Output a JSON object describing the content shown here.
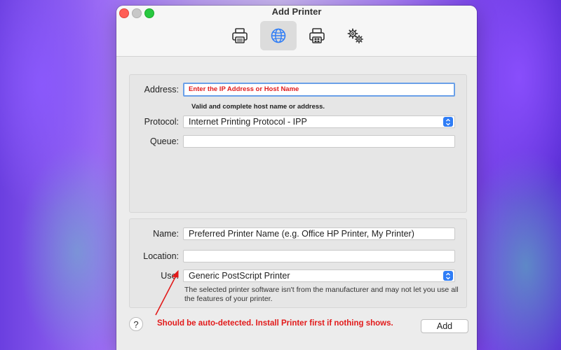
{
  "window": {
    "title": "Add Printer"
  },
  "toolbar": {
    "items": [
      {
        "icon": "printer-icon",
        "selected": false
      },
      {
        "icon": "globe-icon",
        "selected": true
      },
      {
        "icon": "windows-printer-icon",
        "selected": false
      },
      {
        "icon": "gears-icon",
        "selected": false
      }
    ]
  },
  "form": {
    "address": {
      "label": "Address:",
      "value": "Enter the IP Address or Host Name"
    },
    "address_hint": "Valid and complete host name or address.",
    "protocol": {
      "label": "Protocol:",
      "value": "Internet Printing Protocol - IPP"
    },
    "queue": {
      "label": "Queue:",
      "value": ""
    },
    "name": {
      "label": "Name:",
      "value": "Preferred Printer Name (e.g. Office HP Printer, My Printer)"
    },
    "location": {
      "label": "Location:",
      "value": ""
    },
    "use": {
      "label": "Use:",
      "value": "Generic PostScript Printer"
    },
    "use_note": "The selected printer software isn't from the manufacturer and may not let you use all the features of your printer."
  },
  "annotation": {
    "text": "Should be auto-detected. Install Printer first if nothing shows."
  },
  "buttons": {
    "help": "?",
    "add": "Add"
  },
  "colors": {
    "accent": "#2f7df6",
    "annotation": "#e21a1a",
    "focus_ring": "#6aa0e8"
  }
}
